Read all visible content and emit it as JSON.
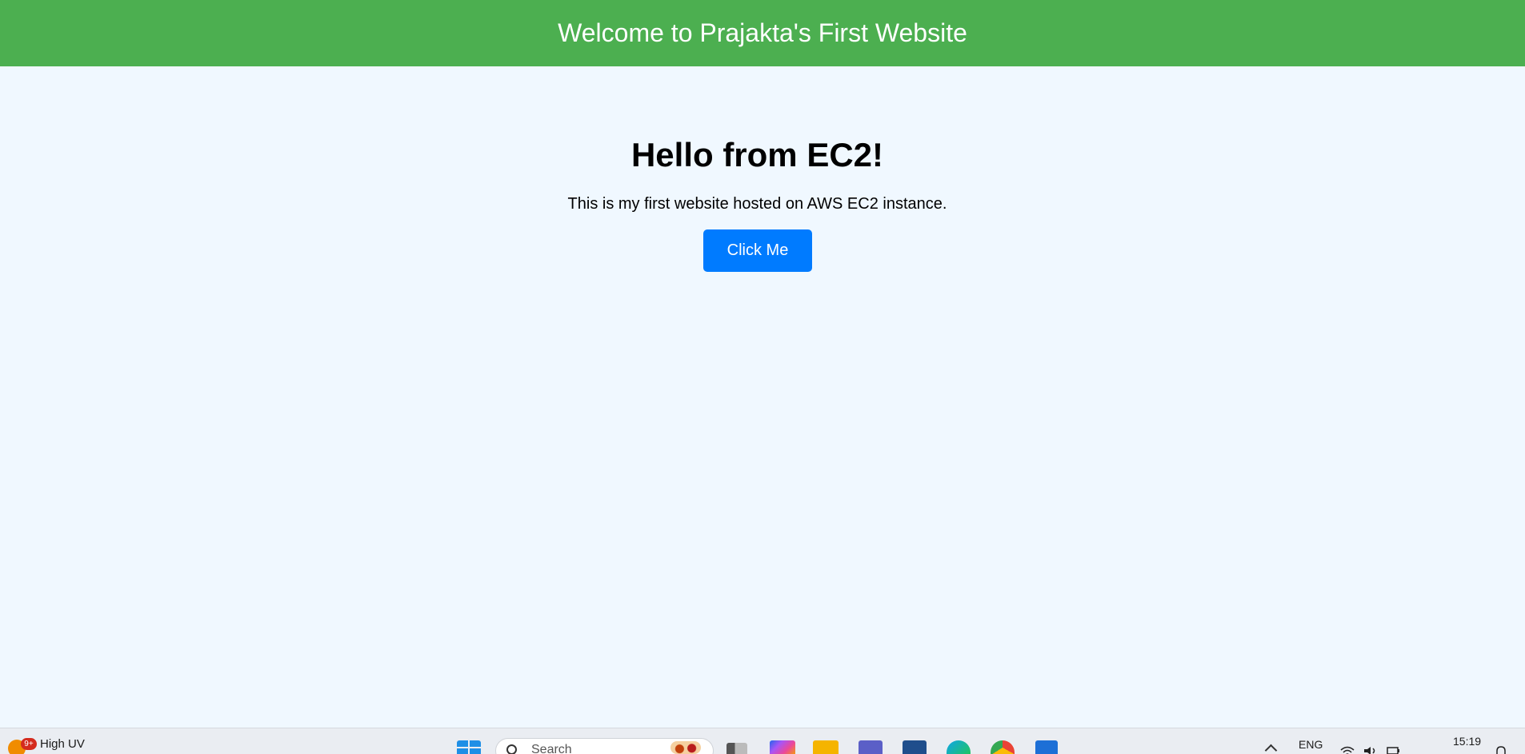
{
  "header": {
    "title": "Welcome to Prajakta's First Website"
  },
  "main": {
    "heading": "Hello from EC2!",
    "description": "This is my first website hosted on AWS EC2 instance.",
    "button_label": "Click Me"
  },
  "colors": {
    "header_bg": "#4caf50",
    "page_bg": "#f0f8ff",
    "button_bg": "#007bff"
  },
  "taskbar": {
    "weather": {
      "badge": "9+",
      "text": "High UV",
      "icon_label": "UV"
    },
    "search": {
      "placeholder": "Search"
    },
    "apps": [
      {
        "name": "start-icon"
      },
      {
        "name": "task-view-icon"
      },
      {
        "name": "copilot-icon"
      },
      {
        "name": "file-explorer-icon"
      },
      {
        "name": "teams-icon"
      },
      {
        "name": "store-icon"
      },
      {
        "name": "edge-icon"
      },
      {
        "name": "chrome-icon"
      },
      {
        "name": "app-icon"
      }
    ],
    "language": "ENG",
    "time": "15:19"
  }
}
